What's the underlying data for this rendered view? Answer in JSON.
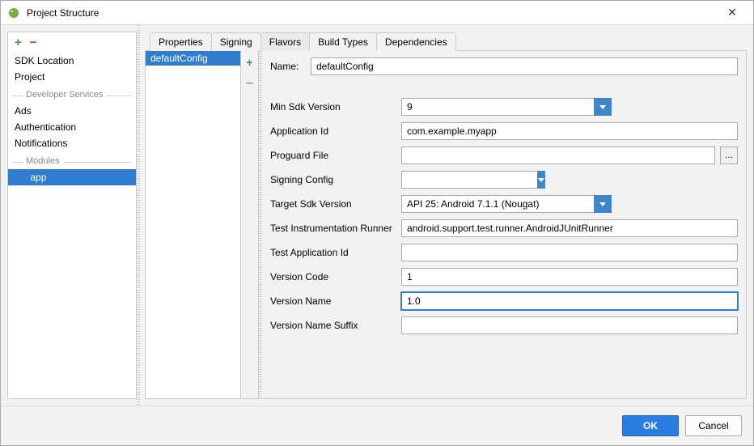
{
  "window": {
    "title": "Project Structure",
    "close": "✕"
  },
  "sidebar": {
    "add": "+",
    "remove": "−",
    "items": [
      {
        "label": "SDK Location"
      },
      {
        "label": "Project"
      }
    ],
    "devHeader": "Developer Services",
    "devItems": [
      {
        "label": "Ads"
      },
      {
        "label": "Authentication"
      },
      {
        "label": "Notifications"
      }
    ],
    "modHeader": "Modules",
    "modItems": [
      {
        "label": "app",
        "selected": true
      }
    ]
  },
  "tabs": [
    "Properties",
    "Signing",
    "Flavors",
    "Build Types",
    "Dependencies"
  ],
  "activeTab": 2,
  "flavors": {
    "items": [
      "defaultConfig"
    ],
    "add": "+",
    "remove": "−"
  },
  "form": {
    "nameLabel": "Name:",
    "name": "defaultConfig",
    "rows": {
      "minSdk": {
        "label": "Min Sdk Version",
        "value": "9",
        "type": "combo"
      },
      "appId": {
        "label": "Application Id",
        "value": "com.example.myapp",
        "type": "text"
      },
      "proguard": {
        "label": "Proguard File",
        "value": "",
        "type": "dots"
      },
      "signing": {
        "label": "Signing Config",
        "value": "",
        "type": "combo-narrow"
      },
      "targetSdk": {
        "label": "Target Sdk Version",
        "value": "API 25: Android 7.1.1 (Nougat)",
        "type": "combo"
      },
      "testRunner": {
        "label": "Test Instrumentation Runner",
        "value": "android.support.test.runner.AndroidJUnitRunner",
        "type": "text"
      },
      "testAppId": {
        "label": "Test Application Id",
        "value": "",
        "type": "text"
      },
      "vCode": {
        "label": "Version Code",
        "value": "1",
        "type": "text"
      },
      "vName": {
        "label": "Version Name",
        "value": "1.0",
        "type": "text",
        "focused": true
      },
      "vSuffix": {
        "label": "Version Name Suffix",
        "value": "",
        "type": "text"
      }
    }
  },
  "footer": {
    "ok": "OK",
    "cancel": "Cancel"
  }
}
